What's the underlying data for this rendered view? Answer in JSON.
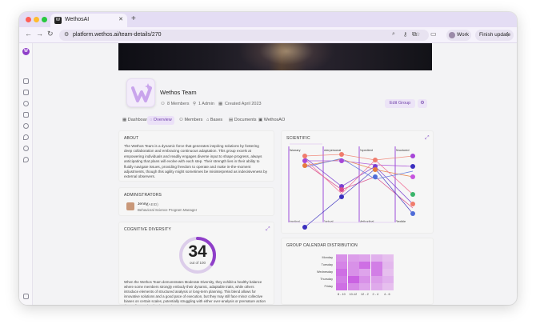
{
  "browser": {
    "tab_title": "WethosAI",
    "tab_favicon": "W",
    "url": "platform.wethos.ai/team-details/270",
    "profile_label": "Work",
    "finish_update_label": "Finish update"
  },
  "sidebar": {
    "logo_letter": "W"
  },
  "team": {
    "name": "Wethos Team",
    "members_count": "8 Members",
    "admin_count": "1 Admin",
    "created": "Created April 2023",
    "edit_label": "Edit Group"
  },
  "tabs": [
    {
      "label": "Dashboard",
      "active": false
    },
    {
      "label": "Overview",
      "active": true
    },
    {
      "label": "Members",
      "active": false
    },
    {
      "label": "Bases",
      "active": false
    },
    {
      "label": "Documents",
      "active": false
    },
    {
      "label": "WethosAO",
      "active": false
    }
  ],
  "about": {
    "title": "ABOUT",
    "text": "The Wethos Team is a dynamic force that generates inspiring solutions by fostering deep collaboration and embracing continuous adaptation. This group excels at empowering individuals and readily engages diverse input to shape progress, always anticipating that plans will evolve with each step. Their strength lies in their ability to fluidly navigate issues, providing freedom to operate and make in-the-moment adjustments, though this agility might sometimes be misinterpreted as indecisiveness by external observers."
  },
  "administrators": {
    "title": "ADMINISTRATORS",
    "name": "Jenny",
    "code": "(AEID)",
    "role": "Behavioral Science Program Manager"
  },
  "diversity": {
    "title": "COGNITIVE DIVERSITY",
    "score": "34",
    "score_sub": "out of 100",
    "score_fraction": 0.34,
    "text": "When the Wethos Team demonstrates Moderate Diversity, they exhibit a healthy balance where some members strongly embody their dynamic, adaptable traits, while others introduce elements of structured analysis or long-term planning. This blend allows for innovative solutions and a good pace of execution, but they may still face minor collective biases on certain scales, potentially struggling with either over-analysis or premature action depending on the dominant voices."
  },
  "scientific": {
    "title": "SCIENTIFIC",
    "top_labels": [
      "Visionary",
      "Interpersonal",
      "Expedient",
      "Structured"
    ],
    "bottom_labels": [
      "Practical",
      "Factual",
      "Methodical",
      "Flexible"
    ]
  },
  "calendar": {
    "title": "GROUP CALENDAR DISTRIBUTION",
    "days": [
      "Monday",
      "Tuesday",
      "Wednesday",
      "Thursday",
      "Friday"
    ],
    "slots": [
      "8 - 10",
      "10-12",
      "12 - 2",
      "2 - 4",
      "4 - 6"
    ],
    "intensity": [
      [
        0.55,
        0.45,
        0.4,
        0.3,
        0.2
      ],
      [
        0.65,
        0.55,
        0.8,
        0.7,
        0.25
      ],
      [
        0.8,
        0.55,
        0.4,
        0.7,
        0.2
      ],
      [
        0.7,
        0.9,
        0.55,
        0.45,
        0.3
      ],
      [
        0.8,
        0.6,
        0.4,
        0.35,
        0.2
      ]
    ]
  },
  "colors": {
    "accent": "#8f3fc9",
    "heat_base": "#c655e0"
  }
}
